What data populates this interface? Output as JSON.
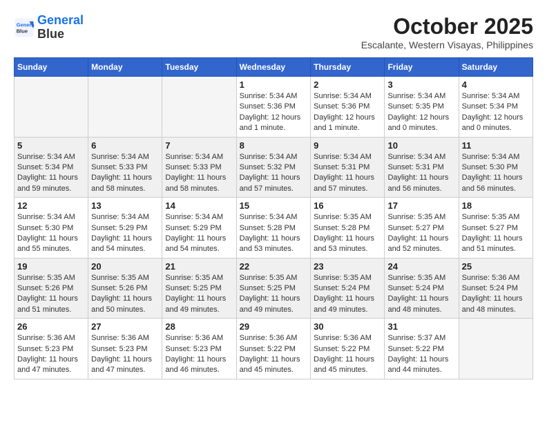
{
  "header": {
    "logo_line1": "General",
    "logo_line2": "Blue",
    "month": "October 2025",
    "location": "Escalante, Western Visayas, Philippines"
  },
  "weekdays": [
    "Sunday",
    "Monday",
    "Tuesday",
    "Wednesday",
    "Thursday",
    "Friday",
    "Saturday"
  ],
  "weeks": [
    [
      {
        "day": "",
        "info": ""
      },
      {
        "day": "",
        "info": ""
      },
      {
        "day": "",
        "info": ""
      },
      {
        "day": "1",
        "info": "Sunrise: 5:34 AM\nSunset: 5:36 PM\nDaylight: 12 hours and 1 minute."
      },
      {
        "day": "2",
        "info": "Sunrise: 5:34 AM\nSunset: 5:36 PM\nDaylight: 12 hours and 1 minute."
      },
      {
        "day": "3",
        "info": "Sunrise: 5:34 AM\nSunset: 5:35 PM\nDaylight: 12 hours and 0 minutes."
      },
      {
        "day": "4",
        "info": "Sunrise: 5:34 AM\nSunset: 5:34 PM\nDaylight: 12 hours and 0 minutes."
      }
    ],
    [
      {
        "day": "5",
        "info": "Sunrise: 5:34 AM\nSunset: 5:34 PM\nDaylight: 11 hours and 59 minutes."
      },
      {
        "day": "6",
        "info": "Sunrise: 5:34 AM\nSunset: 5:33 PM\nDaylight: 11 hours and 58 minutes."
      },
      {
        "day": "7",
        "info": "Sunrise: 5:34 AM\nSunset: 5:33 PM\nDaylight: 11 hours and 58 minutes."
      },
      {
        "day": "8",
        "info": "Sunrise: 5:34 AM\nSunset: 5:32 PM\nDaylight: 11 hours and 57 minutes."
      },
      {
        "day": "9",
        "info": "Sunrise: 5:34 AM\nSunset: 5:31 PM\nDaylight: 11 hours and 57 minutes."
      },
      {
        "day": "10",
        "info": "Sunrise: 5:34 AM\nSunset: 5:31 PM\nDaylight: 11 hours and 56 minutes."
      },
      {
        "day": "11",
        "info": "Sunrise: 5:34 AM\nSunset: 5:30 PM\nDaylight: 11 hours and 56 minutes."
      }
    ],
    [
      {
        "day": "12",
        "info": "Sunrise: 5:34 AM\nSunset: 5:30 PM\nDaylight: 11 hours and 55 minutes."
      },
      {
        "day": "13",
        "info": "Sunrise: 5:34 AM\nSunset: 5:29 PM\nDaylight: 11 hours and 54 minutes."
      },
      {
        "day": "14",
        "info": "Sunrise: 5:34 AM\nSunset: 5:29 PM\nDaylight: 11 hours and 54 minutes."
      },
      {
        "day": "15",
        "info": "Sunrise: 5:34 AM\nSunset: 5:28 PM\nDaylight: 11 hours and 53 minutes."
      },
      {
        "day": "16",
        "info": "Sunrise: 5:35 AM\nSunset: 5:28 PM\nDaylight: 11 hours and 53 minutes."
      },
      {
        "day": "17",
        "info": "Sunrise: 5:35 AM\nSunset: 5:27 PM\nDaylight: 11 hours and 52 minutes."
      },
      {
        "day": "18",
        "info": "Sunrise: 5:35 AM\nSunset: 5:27 PM\nDaylight: 11 hours and 51 minutes."
      }
    ],
    [
      {
        "day": "19",
        "info": "Sunrise: 5:35 AM\nSunset: 5:26 PM\nDaylight: 11 hours and 51 minutes."
      },
      {
        "day": "20",
        "info": "Sunrise: 5:35 AM\nSunset: 5:26 PM\nDaylight: 11 hours and 50 minutes."
      },
      {
        "day": "21",
        "info": "Sunrise: 5:35 AM\nSunset: 5:25 PM\nDaylight: 11 hours and 49 minutes."
      },
      {
        "day": "22",
        "info": "Sunrise: 5:35 AM\nSunset: 5:25 PM\nDaylight: 11 hours and 49 minutes."
      },
      {
        "day": "23",
        "info": "Sunrise: 5:35 AM\nSunset: 5:24 PM\nDaylight: 11 hours and 49 minutes."
      },
      {
        "day": "24",
        "info": "Sunrise: 5:35 AM\nSunset: 5:24 PM\nDaylight: 11 hours and 48 minutes."
      },
      {
        "day": "25",
        "info": "Sunrise: 5:36 AM\nSunset: 5:24 PM\nDaylight: 11 hours and 48 minutes."
      }
    ],
    [
      {
        "day": "26",
        "info": "Sunrise: 5:36 AM\nSunset: 5:23 PM\nDaylight: 11 hours and 47 minutes."
      },
      {
        "day": "27",
        "info": "Sunrise: 5:36 AM\nSunset: 5:23 PM\nDaylight: 11 hours and 47 minutes."
      },
      {
        "day": "28",
        "info": "Sunrise: 5:36 AM\nSunset: 5:23 PM\nDaylight: 11 hours and 46 minutes."
      },
      {
        "day": "29",
        "info": "Sunrise: 5:36 AM\nSunset: 5:22 PM\nDaylight: 11 hours and 45 minutes."
      },
      {
        "day": "30",
        "info": "Sunrise: 5:36 AM\nSunset: 5:22 PM\nDaylight: 11 hours and 45 minutes."
      },
      {
        "day": "31",
        "info": "Sunrise: 5:37 AM\nSunset: 5:22 PM\nDaylight: 11 hours and 44 minutes."
      },
      {
        "day": "",
        "info": ""
      }
    ]
  ]
}
